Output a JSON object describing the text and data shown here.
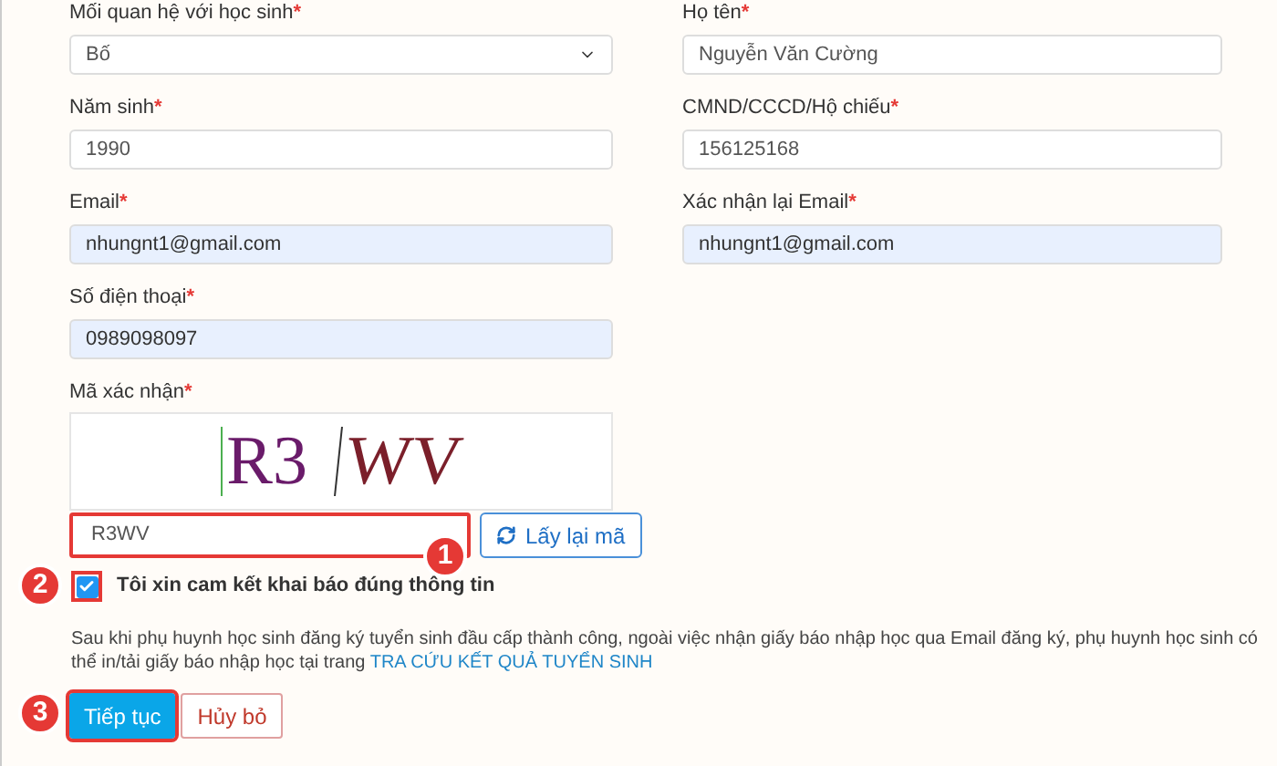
{
  "fields_left": [
    {
      "kind": "select",
      "label": "Mối quan hệ với học sinh",
      "required": "*",
      "value": "Bố",
      "filled": false
    },
    {
      "kind": "text",
      "label": "Năm sinh",
      "required": "*",
      "value": "1990",
      "filled": false
    },
    {
      "kind": "text",
      "label": "Email",
      "required": "*",
      "value": "nhungnt1@gmail.com",
      "filled": true
    },
    {
      "kind": "text",
      "label": "Số điện thoại",
      "required": "*",
      "value": "0989098097",
      "filled": true
    }
  ],
  "fields_right": [
    {
      "kind": "text",
      "label": "Họ tên",
      "required": "*",
      "value": "Nguyễn Văn Cường",
      "filled": false
    },
    {
      "kind": "text",
      "label": "CMND/CCCD/Hộ chiếu",
      "required": "*",
      "value": "156125168",
      "filled": false
    },
    {
      "kind": "text",
      "label": "Xác nhận lại Email",
      "required": "*",
      "value": "nhungnt1@gmail.com",
      "filled": true
    }
  ],
  "captcha": {
    "label": "Mã xác nhận",
    "required": "*",
    "image_text": [
      "R3",
      "WV"
    ],
    "value": "R3WV",
    "highlighted": true,
    "marker": "1",
    "refresh_button": "Lấy lại mã"
  },
  "agreement": {
    "label": "Tôi xin cam kết khai báo đúng thông tin",
    "checked": true,
    "highlighted": true,
    "marker": "2"
  },
  "note": {
    "text": "Sau khi phụ huynh học sinh đăng ký tuyển sinh đầu cấp thành công, ngoài việc nhận giấy báo nhập học qua Email đăng ký, phụ huynh học sinh có thể in/tải giấy báo nhập học tại trang",
    "link": "TRA CỨU KẾT QUẢ TUYỂN SINH"
  },
  "buttons": [
    {
      "label": "Tiếp tục",
      "kind": "primary",
      "highlighted": true,
      "marker": "3"
    },
    {
      "label": "Hủy bỏ",
      "kind": "cancel",
      "highlighted": false
    }
  ]
}
